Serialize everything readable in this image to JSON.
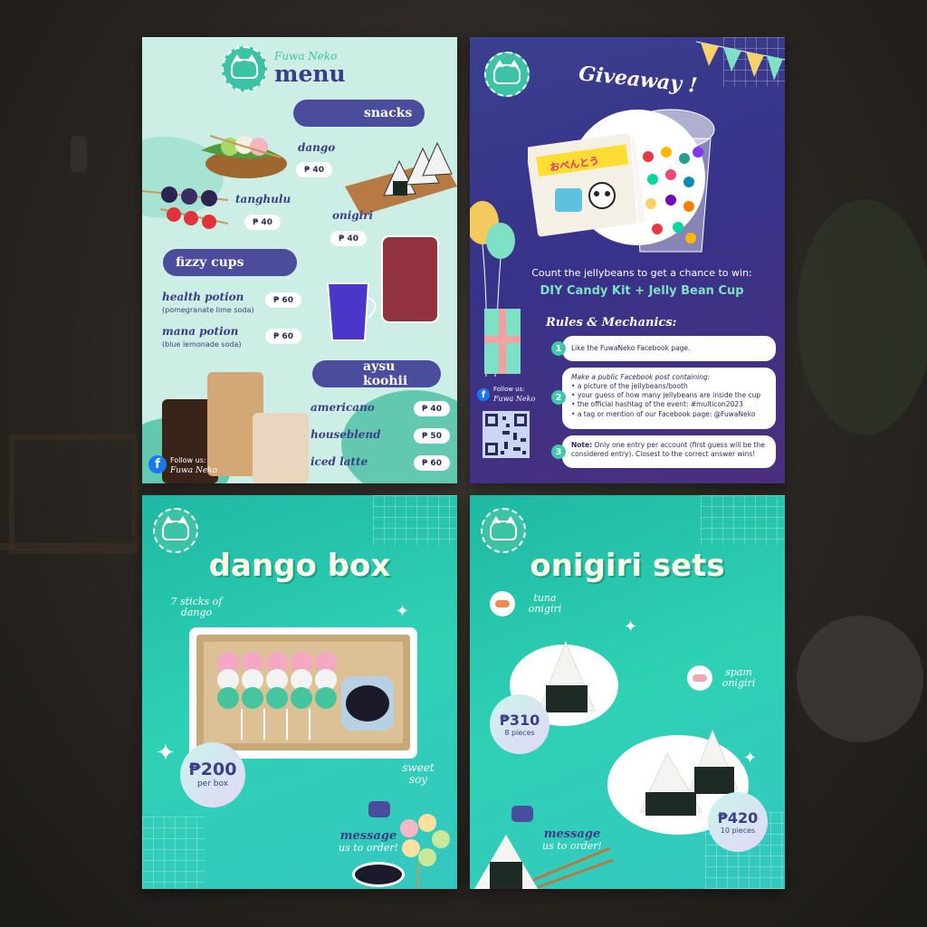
{
  "menu": {
    "brand": "Fuwa Neko",
    "title": "menu",
    "sections": {
      "snacks": "snacks",
      "fizzy": "fizzy cups",
      "coffee": "aysu koohii"
    },
    "items": {
      "dango": {
        "name": "dango",
        "price": "₱ 40"
      },
      "tanghulu": {
        "name": "tanghulu",
        "price": "₱ 40"
      },
      "onigiri": {
        "name": "onigiri",
        "price": "₱ 40"
      },
      "health": {
        "name": "health potion",
        "sub": "(pomegranate lime soda)",
        "price": "₱ 60"
      },
      "mana": {
        "name": "mana potion",
        "sub": "(blue lemonade soda)",
        "price": "₱ 60"
      },
      "americano": {
        "name": "americano",
        "price": "₱ 40"
      },
      "houseblend": {
        "name": "houseblend",
        "price": "₱ 50"
      },
      "latte": {
        "name": "iced latte",
        "price": "₱ 60"
      }
    },
    "follow_label": "Follow us:",
    "follow_name": "Fuwa Neko"
  },
  "giveaway": {
    "title": "Giveaway !",
    "kit_text": "おべんとう",
    "prompt": "Count the jellybeans to get a chance to win:",
    "prize": "DIY Candy Kit + Jelly Bean Cup",
    "rules_title": "Rules & Mechanics:",
    "rules": [
      {
        "num": "1",
        "text": "Like the FuwaNeko Facebook page."
      },
      {
        "num": "2",
        "intro": "Make a public Facebook post containing:",
        "bullets": [
          "a picture of the jellybeans/booth",
          "your guess of how many jellybeans are inside the cup",
          "the official hashtag of the event: #multicon2023",
          "a tag or mention of our Facebook page: @FuwaNeko"
        ]
      },
      {
        "num": "3",
        "bold": "Note:",
        "text": " Only one entry per account (first guess will be the considered entry). Closest to the correct answer wins!"
      }
    ],
    "follow_label": "Follow us:",
    "follow_name": "Fuwa Neko"
  },
  "dango_box": {
    "title": "dango box",
    "sticks_note": "7 sticks of dango",
    "price": "₱200",
    "price_unit": "per box",
    "soy_note": "sweet soy",
    "message_big": "message",
    "message_small": "us to order!"
  },
  "onigiri_sets": {
    "title": "onigiri sets",
    "tuna": "tuna onigiri",
    "spam": "spam onigiri",
    "price_small": "₱310",
    "price_small_unit": "8 pieces",
    "price_large": "₱420",
    "price_large_unit": "10 pieces",
    "message_big": "message",
    "message_small": "us to order!"
  },
  "colors": {
    "menu_bg": "#cdeee4",
    "navy_pill": "#4b4c9b",
    "mint": "#3cc3a6",
    "teal": "#2fd1b5",
    "giveaway_bg": "#37338a",
    "prize_text": "#7ee0c4"
  }
}
